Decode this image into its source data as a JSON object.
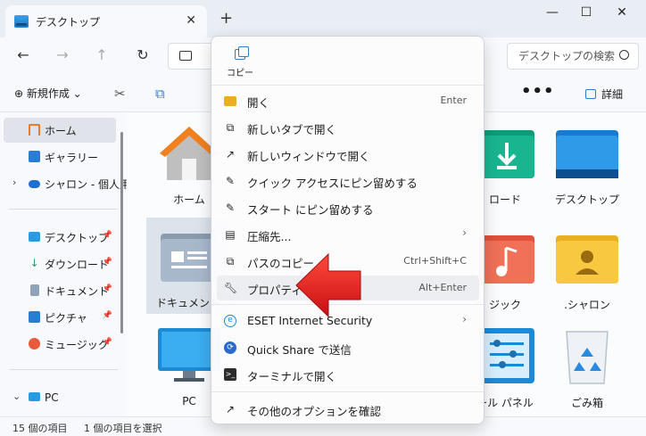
{
  "window": {
    "tab_title": "デスクトップ",
    "tab_close": "✕",
    "new_tab": "+",
    "minimize": "—",
    "maximize": "☐",
    "close": "✕"
  },
  "nav": {
    "back": "←",
    "forward": "→",
    "up": "↑",
    "refresh": "↻"
  },
  "search": {
    "placeholder": "デスクトップの検索"
  },
  "toolbar": {
    "new_label": "⊕ 新規作成 ⌄",
    "cut": "✂",
    "copy": "⧉",
    "more": "•••",
    "details": "詳細"
  },
  "sidebar": {
    "items": [
      {
        "label": "ホーム"
      },
      {
        "label": "ギャラリー"
      },
      {
        "label": "シャロン - 個人用"
      },
      {
        "label": "デスクトップ"
      },
      {
        "label": "ダウンロード"
      },
      {
        "label": "ドキュメント"
      },
      {
        "label": "ピクチャ"
      },
      {
        "label": "ミュージック"
      },
      {
        "label": "PC"
      }
    ]
  },
  "files": {
    "home": "ホーム",
    "documents": "ドキュメント",
    "pc": "PC",
    "downloads": "ロード",
    "desktop": "デスクトップ",
    "sharon": ".シャロン",
    "music": "ジック",
    "control_panel": "ール パネル",
    "recycle": "ごみ箱"
  },
  "status": {
    "count": "15 個の項目",
    "selected": "1 個の項目を選択"
  },
  "context_menu": {
    "copy_label": "コピー",
    "items": [
      {
        "label": "開く",
        "shortcut": "Enter"
      },
      {
        "label": "新しいタブで開く"
      },
      {
        "label": "新しいウィンドウで開く"
      },
      {
        "label": "クイック アクセスにピン留めする"
      },
      {
        "label": "スタート にピン留めする"
      },
      {
        "label": "圧縮先..."
      },
      {
        "label": "パスのコピー",
        "shortcut": "Ctrl+Shift+C"
      },
      {
        "label": "プロパティ",
        "shortcut": "Alt+Enter"
      },
      {
        "label": "ESET Internet Security"
      },
      {
        "label": "Quick Share で送信"
      },
      {
        "label": "ターミナルで開く"
      },
      {
        "label": "その他のオプションを確認"
      }
    ]
  },
  "colors": {
    "arrow": "#e0191c",
    "accent": "#2a7dd0"
  }
}
